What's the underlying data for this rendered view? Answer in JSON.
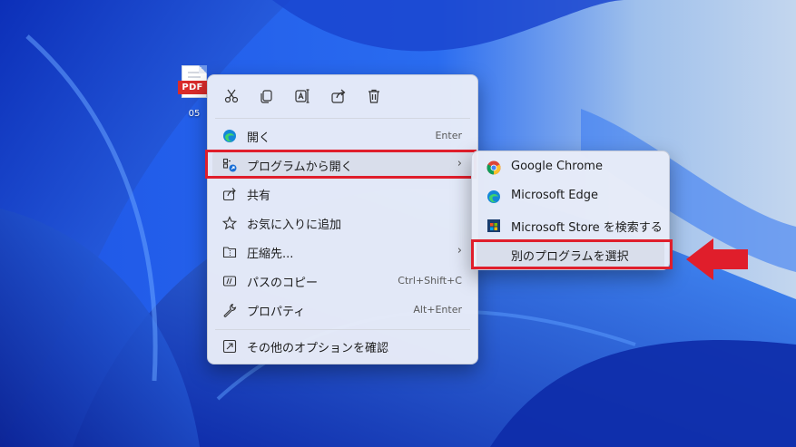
{
  "desktop": {
    "file_icon": {
      "badge": "PDF",
      "name": "05"
    }
  },
  "toolbar": {
    "buttons": [
      "cut-icon",
      "copy-icon",
      "rename-icon",
      "share-icon",
      "delete-icon"
    ]
  },
  "context_menu": {
    "items": [
      {
        "icon": "edge-icon",
        "label": "開く",
        "shortcut": "Enter"
      },
      {
        "icon": "open-with-icon",
        "label": "プログラムから開く",
        "has_submenu": true
      },
      {
        "icon": "share-icon",
        "label": "共有"
      },
      {
        "icon": "star-icon",
        "label": "お気に入りに追加"
      },
      {
        "icon": "zip-icon",
        "label": "圧縮先...",
        "has_submenu": true
      },
      {
        "icon": "path-icon",
        "label": "パスのコピー",
        "shortcut": "Ctrl+Shift+C"
      },
      {
        "icon": "wrench-icon",
        "label": "プロパティ",
        "shortcut": "Alt+Enter"
      },
      {
        "icon": "more-options-icon",
        "label": "その他のオプションを確認"
      }
    ]
  },
  "submenu": {
    "items": [
      {
        "icon": "chrome-icon",
        "label": "Google Chrome"
      },
      {
        "icon": "edge-icon",
        "label": "Microsoft Edge"
      },
      {
        "icon": "store-icon",
        "label": "Microsoft Store を検索する"
      },
      {
        "label": "別のプログラムを選択"
      }
    ]
  },
  "colors": {
    "highlight_box": "#e01e2b",
    "arrow": "#e01e2b",
    "wallpaper_blue": "#1d4fd8"
  }
}
